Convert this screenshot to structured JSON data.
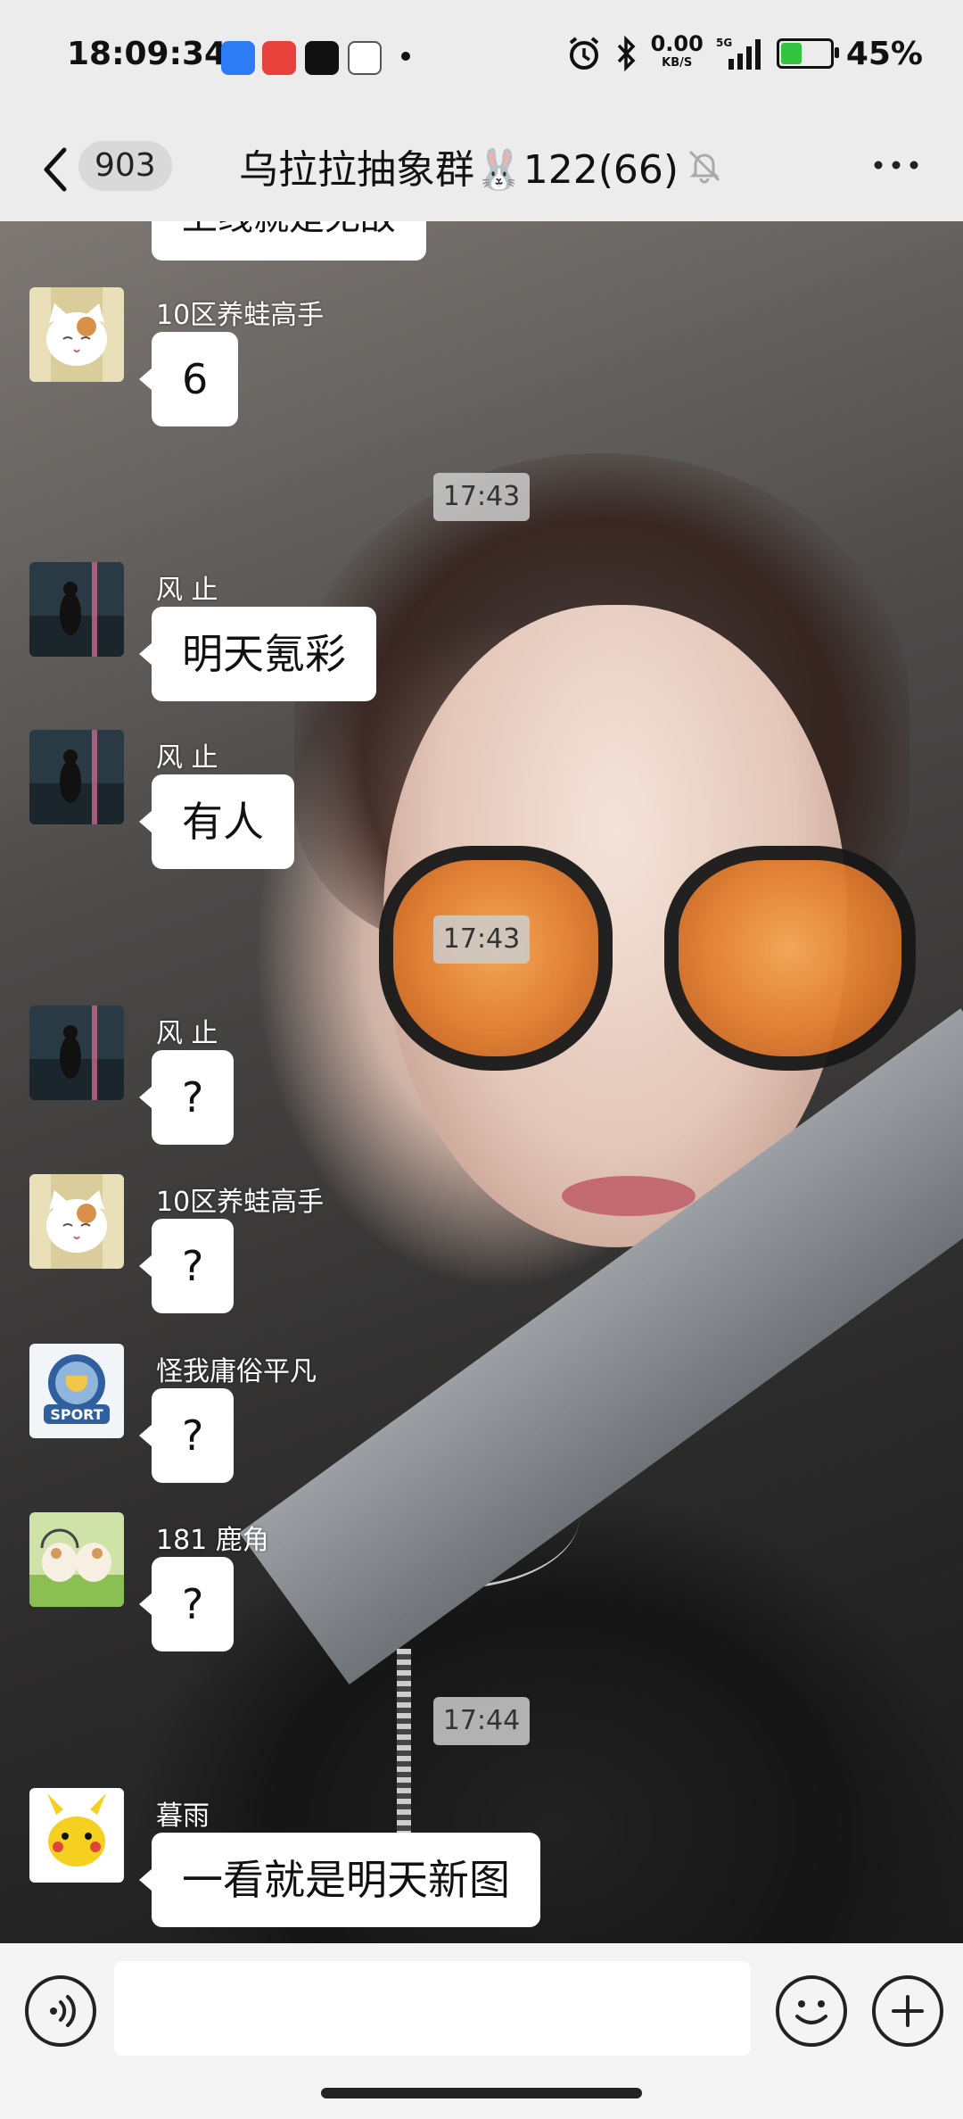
{
  "status_bar": {
    "time": "18:09:34",
    "net_speed": "0.00",
    "net_unit": "KB/S",
    "battery_percent": 45,
    "battery_label": "45%",
    "icons": [
      "app-icon-blue",
      "toutiao-icon",
      "tiktok-icon",
      "game-icon",
      "alarm-icon",
      "bluetooth-icon",
      "5g-signal-icon",
      "battery-icon"
    ]
  },
  "header": {
    "unread_count": "903",
    "title": "乌拉拉抽象群🐰122(66)",
    "icons": [
      "back-arrow-icon",
      "mute-bell-icon",
      "more-icon"
    ]
  },
  "messages": [
    {
      "kind": "partial",
      "text": "上线就是无敌"
    },
    {
      "kind": "msg",
      "sender": "10区养蛙高手",
      "text": "6",
      "avatar": "cat-avatar"
    },
    {
      "kind": "time",
      "text": "17:43"
    },
    {
      "kind": "msg",
      "sender": "风 止",
      "text": "明天氪彩",
      "avatar": "night-avatar"
    },
    {
      "kind": "msg",
      "sender": "风 止",
      "text": "有人",
      "avatar": "night-avatar"
    },
    {
      "kind": "time",
      "text": "17:43"
    },
    {
      "kind": "msg",
      "sender": "风 止",
      "text": "?",
      "avatar": "night-avatar"
    },
    {
      "kind": "msg",
      "sender": "10区养蛙高手",
      "text": "?",
      "avatar": "cat-avatar"
    },
    {
      "kind": "msg",
      "sender": "怪我庸俗平凡",
      "text": "?",
      "avatar": "sport-avatar"
    },
    {
      "kind": "msg",
      "sender": "181 鹿角",
      "text": "?",
      "avatar": "cats-avatar"
    },
    {
      "kind": "time",
      "text": "17:44"
    },
    {
      "kind": "msg",
      "sender": "暮雨",
      "text": "一看就是明天新图",
      "avatar": "pikachu-avatar"
    }
  ],
  "avatar_badge_text": "SPORT",
  "input": {
    "value": "",
    "placeholder": ""
  },
  "colors": {
    "bubble": "#ffffff",
    "header_bg": "#ececec",
    "battery_green": "#35c43f"
  }
}
